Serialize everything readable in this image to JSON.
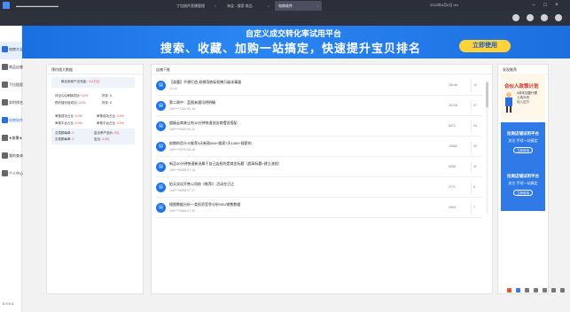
{
  "titlebar": {
    "tabs": [
      {
        "label": "▬▬▬▬▬▬▬▬▬▬▬▬",
        "active": false
      },
      {
        "label": "丁包插件直播管理",
        "active": false
      },
      {
        "label": "淘宝 - 搜索 商品",
        "active": false
      },
      {
        "label": "电商软件",
        "active": true
      }
    ],
    "status": "2022年4月4日 ▪▪▪▪"
  },
  "sidebar": {
    "items": [
      {
        "label": "电商大全",
        "color": "#2a6fdc"
      },
      {
        "label": "商品自查",
        "color": "#666666"
      },
      {
        "label": "下拉搜索",
        "color": "#666666"
      },
      {
        "label": "实时排名",
        "color": "#666666"
      },
      {
        "label": "电商软件",
        "color": "#2a6fdc"
      },
      {
        "label": "★紫薯★",
        "color": "#666666"
      },
      {
        "label": "我的查询",
        "color": "#666666"
      },
      {
        "label": "个人中心",
        "color": "#666666"
      }
    ]
  },
  "banner": {
    "line1": "自定义成交转化率试用平台",
    "line2": "搜索、收藏、加购一站搞定，快速提升宝贝排名",
    "button": "立即使用"
  },
  "left_panel": {
    "title": "预约搜大数据",
    "block1": [
      {
        "label": "新店卖家产出流量",
        "value": "4.0万元"
      }
    ],
    "block2": [
      {
        "label": "评论/QQ审核成功:",
        "value": "0.0%",
        "label2": "好评:",
        "value2": "0"
      },
      {
        "label": "预约搜可信成功:",
        "value": "0.0%",
        "label2": "好评:",
        "value2": "0"
      }
    ],
    "block3": [
      {
        "label": "审核成功占比:",
        "value": "0.0%",
        "label2": "审核成功占比:",
        "value2": "0.0%"
      },
      {
        "label": "审核平台占比:",
        "value": "0.0%",
        "label2": "审核平台占比:",
        "value2": "0.0%"
      }
    ],
    "block4": [
      {
        "label": "交易额每单:",
        "value": "0",
        "label2": "复出率产品价:",
        "value2": "0元"
      },
      {
        "label": "交易额每单:",
        "value": "0",
        "label2": "复出:",
        "value2": "4.0元"
      }
    ]
  },
  "center_panel": {
    "title": "店铺下推",
    "items": [
      {
        "title": "【泼墨】不想打造,却想用商标权搏万级本事量",
        "meta": "10-10",
        "views": "26146",
        "count": "13"
      },
      {
        "title": "第二周中：蓝图来通讯明明确",
        "meta": "155****7253    09-16",
        "views": "26728",
        "count": "27"
      },
      {
        "title": "超级云商来让你10分钟快速创出商摆设搭配",
        "meta": "155****0069    09-11",
        "views": "5572",
        "count": "24"
      },
      {
        "title": "前期的用卡卡推荐3天新款600+搜索7天1300+搜索的",
        "meta": "155****2079    08-18",
        "views": "10962",
        "count": "29"
      },
      {
        "title": "新品30分钟快速新选属于自己店权的是商金标题（超高标题+建立流程）",
        "meta": "155****8468    07-18",
        "views": "5288",
        "count": "11"
      },
      {
        "title": "拍天实况开售公用前《推荐》,活动在日之",
        "meta": "155****6058    07-17",
        "views": "2771",
        "count": "8"
      },
      {
        "title": "搜图数据分析一类投资竞争分析SKU销售数据",
        "meta": "156****2884    07-02",
        "views": "2994",
        "count": "7"
      }
    ]
  },
  "right_panel": {
    "title": "发现推荐",
    "ad_top": {
      "line1": "合伙人政策计划",
      "line2": "0成本加盟代理\n上线30天\n月入过万",
      "icon": "person-figure"
    },
    "ads": [
      {
        "line1": "拉商店铺试用平台",
        "line2": "关注·手续一站搞定",
        "button": "立即使用"
      },
      {
        "line1": "拉商店铺试用平台",
        "line2": "关注·手续一站搞定",
        "button": "立即使用"
      }
    ]
  },
  "page_footer": "5  9  6  4",
  "colors": {
    "accent": "#2a6fdc",
    "value_red": "#e0403a",
    "titlebar": "#2b2f3a"
  }
}
